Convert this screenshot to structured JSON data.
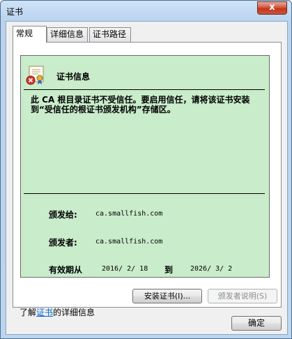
{
  "window": {
    "title": "证书",
    "close_label": "x"
  },
  "tabs": [
    {
      "label": "常规",
      "active": true
    },
    {
      "label": "详细信息",
      "active": false
    },
    {
      "label": "证书路径",
      "active": false
    }
  ],
  "certificate": {
    "header": "证书信息",
    "message": "此 CA 根目录证书不受信任。要启用信任，请将该证书安装到“受信任的根证书颁发机构”存储区。",
    "issued_to_label": "颁发给:",
    "issued_to_value": "ca.smallfish.com",
    "issued_by_label": "颁发者:",
    "issued_by_value": "ca.smallfish.com",
    "valid_label": "有效期从",
    "valid_from": "2016/ 2/ 18",
    "valid_to_word": "到",
    "valid_to": "2026/ 3/ 2"
  },
  "buttons": {
    "install": "安装证书(I)...",
    "issuer_statement": "颁发者说明(S)",
    "ok": "确定"
  },
  "learn_more": {
    "prefix": "了解",
    "link": "证书",
    "suffix": "的详细信息"
  },
  "colors": {
    "cert_background": "#c9eccb",
    "link": "#0066cc",
    "close_button": "#c2361c"
  },
  "icons": {
    "certificate": "certificate-error-icon"
  }
}
